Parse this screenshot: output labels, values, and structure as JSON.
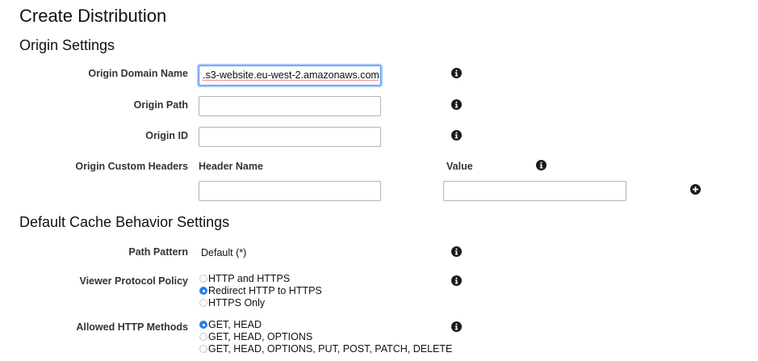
{
  "page_title": "Create Distribution",
  "origin_settings": {
    "heading": "Origin Settings",
    "origin_domain_name": {
      "label": "Origin Domain Name",
      "value": ".s3-website.eu-west-2.amazonaws.com"
    },
    "origin_path": {
      "label": "Origin Path",
      "value": ""
    },
    "origin_id": {
      "label": "Origin ID",
      "value": ""
    },
    "custom_headers": {
      "label": "Origin Custom Headers",
      "header_name_label": "Header Name",
      "value_label": "Value",
      "header_name_value": "",
      "value_value": ""
    }
  },
  "cache_behavior": {
    "heading": "Default Cache Behavior Settings",
    "path_pattern": {
      "label": "Path Pattern",
      "value": "Default (*)"
    },
    "viewer_protocol_policy": {
      "label": "Viewer Protocol Policy",
      "options": [
        "HTTP and HTTPS",
        "Redirect HTTP to HTTPS",
        "HTTPS Only"
      ],
      "selected": 1
    },
    "allowed_http_methods": {
      "label": "Allowed HTTP Methods",
      "options": [
        "GET, HEAD",
        "GET, HEAD, OPTIONS",
        "GET, HEAD, OPTIONS, PUT, POST, PATCH, DELETE"
      ],
      "selected": 0
    }
  },
  "icons": {
    "info": "info-icon",
    "add": "plus-circle-icon"
  },
  "colors": {
    "focus": "#4d90fe",
    "radio_selected": "#2b7de9",
    "input_border": "#aab7b8"
  }
}
